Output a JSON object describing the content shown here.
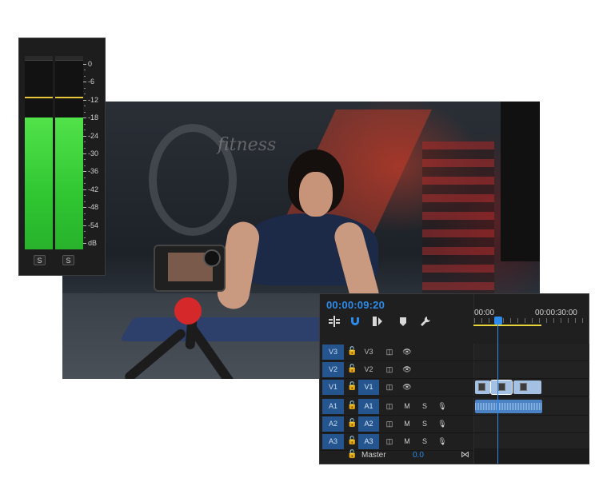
{
  "meter": {
    "scale": [
      "0",
      "-6",
      "-12",
      "-18",
      "-24",
      "-30",
      "-36",
      "-42",
      "-48",
      "-54",
      "dB"
    ],
    "levels_db": [
      -18,
      -18
    ],
    "peak_db": -11,
    "solo_labels": [
      "S",
      "S"
    ]
  },
  "timeline": {
    "timecode": "00:00:09:20",
    "ruler": [
      "00:00",
      "00:00:30:00"
    ],
    "tools": [
      "insert-snap-icon",
      "magnet-icon",
      "linked-selection-icon",
      "marker-icon",
      "wrench-icon"
    ],
    "video_tracks": [
      {
        "target": "V3",
        "source": "V3",
        "source_active": false
      },
      {
        "target": "V2",
        "source": "V2",
        "source_active": false
      },
      {
        "target": "V1",
        "source": "V1",
        "source_active": true
      }
    ],
    "audio_tracks": [
      {
        "target": "A1",
        "source": "A1",
        "mute": "M",
        "solo": "S"
      },
      {
        "target": "A2",
        "source": "A2",
        "mute": "M",
        "solo": "S"
      },
      {
        "target": "A3",
        "source": "A3",
        "mute": "M",
        "solo": "S"
      }
    ],
    "master": {
      "label": "Master",
      "value": "0.0"
    }
  },
  "colors": {
    "accent_blue": "#2d8ceb",
    "track_target": "#25558f",
    "meter_green": "#2fc631",
    "peak_yellow": "#e6c63a"
  }
}
